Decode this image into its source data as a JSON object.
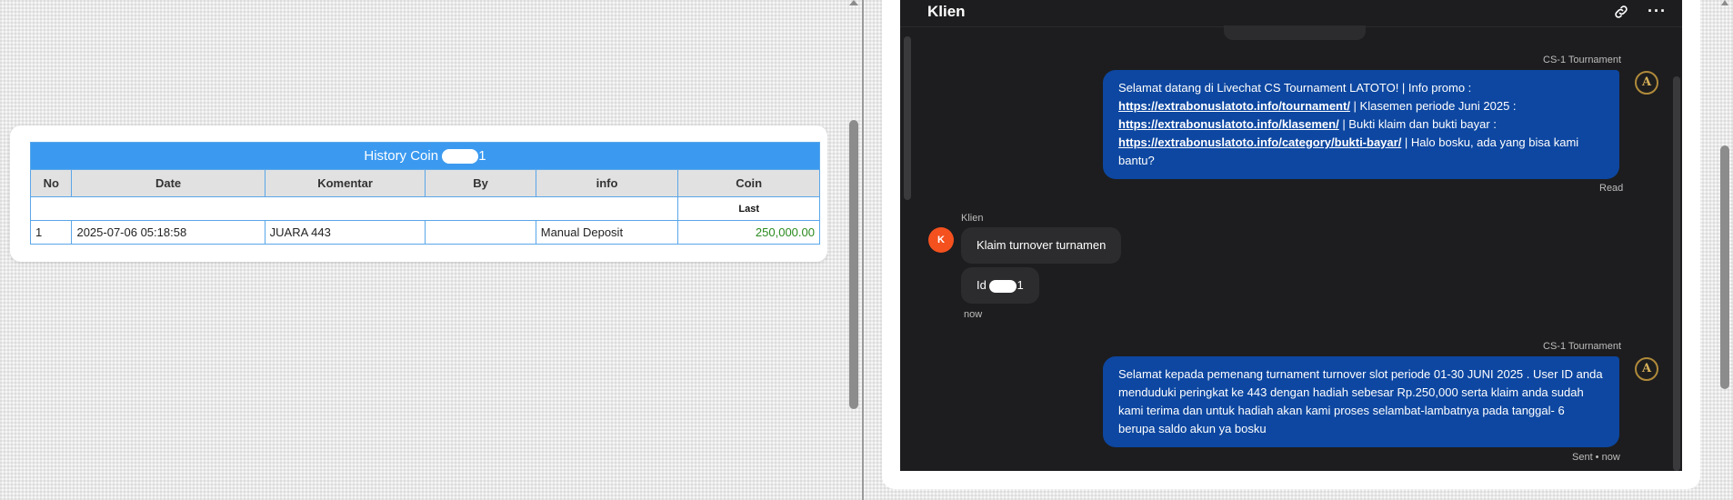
{
  "history": {
    "title_prefix": "History Coin",
    "title_suffix": "1",
    "columns": [
      "No",
      "Date",
      "Komentar",
      "By",
      "info",
      "Coin"
    ],
    "last_label": "Last",
    "rows": [
      {
        "no": "1",
        "date": "2025-07-06 05:18:58",
        "komentar": "JUARA 443",
        "by": "",
        "info": "Manual Deposit",
        "coin": "250,000.00"
      }
    ]
  },
  "chat": {
    "title": "Klien",
    "agent_name": "CS-1 Tournament",
    "client_name": "Klien",
    "client_initial": "K",
    "agent_initial": "A",
    "msg1": {
      "t1": "Selamat datang di Livechat CS Tournament LATOTO! | Info promo :",
      "link1": "https://extrabonuslatoto.info/tournament/",
      "t2": " | Klasemen periode Juni 2025 :",
      "link2": "https://extrabonuslatoto.info/klasemen/",
      "t3": " | Bukti klaim dan bukti bayar :",
      "link3": "https://extrabonuslatoto.info/category/bukti-bayar/",
      "t4": " | Halo bosku, ada yang bisa kami bantu?",
      "status": "Read"
    },
    "in1": "Klaim turnover turnamen",
    "in2_prefix": "Id",
    "in2_suffix": "1",
    "in_time": "now",
    "msg2": {
      "text": "Selamat kepada pemenang turnament turnover slot periode 01-30 JUNI 2025 . User ID anda menduduki peringkat ke 443 dengan hadiah sebesar Rp.250,000 serta klaim anda sudah kami terima dan untuk hadiah akan kami proses selambat-lambatnya pada tanggal- 6 berupa saldo akun ya bosku",
      "status": "Sent • now"
    }
  },
  "icons": {
    "link": "link-icon",
    "more": "more-icon"
  }
}
